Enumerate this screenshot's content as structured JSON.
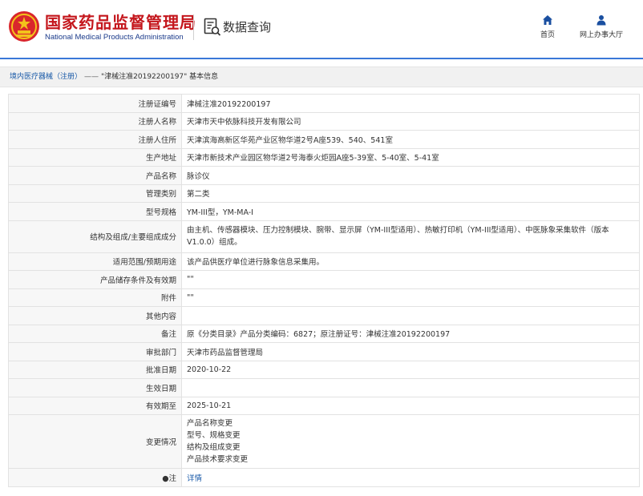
{
  "header": {
    "title_cn": "国家药品监督管理局",
    "title_en": "National Medical Products Administration",
    "query_label": "数据查询",
    "nav": [
      {
        "label": "首页",
        "icon": "home-icon"
      },
      {
        "label": "网上办事大厅",
        "icon": "user-icon"
      }
    ]
  },
  "breadcrumb": {
    "parent": "境内医疗器械（注册）",
    "separator": "——",
    "current": "\"津械注准20192200197\" 基本信息"
  },
  "rows": [
    {
      "key": "注册证编号",
      "value": "津械注准20192200197"
    },
    {
      "key": "注册人名称",
      "value": "天津市天中依脉科技开发有限公司"
    },
    {
      "key": "注册人住所",
      "value": "天津滨海高新区华苑产业区物华道2号A座539、540、541室"
    },
    {
      "key": "生产地址",
      "value": "天津市新技术产业园区物华道2号海泰火炬园A座5-39室、5-40室、5-41室"
    },
    {
      "key": "产品名称",
      "value": "脉诊仪"
    },
    {
      "key": "管理类别",
      "value": "第二类"
    },
    {
      "key": "型号规格",
      "value": "YM-III型，YM-MA-I"
    },
    {
      "key": "结构及组成/主要组成成分",
      "value": "由主机、传感器模块、压力控制模块、腕带、显示屏（YM-III型适用）、热敏打印机（YM-III型适用）、中医脉象采集软件（版本V1.0.0）组成。"
    },
    {
      "key": "适用范围/预期用途",
      "value": "该产品供医疗单位进行脉象信息采集用。"
    },
    {
      "key": "产品储存条件及有效期",
      "value": "\"\""
    },
    {
      "key": "附件",
      "value": "\"\""
    },
    {
      "key": "其他内容",
      "value": ""
    },
    {
      "key": "备注",
      "value": "原《分类目录》产品分类编码：6827；原注册证号：津械注准20192200197"
    },
    {
      "key": "审批部门",
      "value": "天津市药品监督管理局"
    },
    {
      "key": "批准日期",
      "value": "2020-10-22"
    },
    {
      "key": "生效日期",
      "value": ""
    },
    {
      "key": "有效期至",
      "value": "2025-10-21"
    }
  ],
  "changes": {
    "key": "变更情况",
    "items": [
      "产品名称变更",
      "型号、规格变更",
      "结构及组成变更",
      "产品技术要求变更"
    ]
  },
  "note": {
    "key": "注",
    "link": "详情"
  },
  "colors": {
    "brand_red": "#c4161c",
    "brand_blue": "#1a3a8a",
    "accent_blue": "#3a78d8",
    "link_blue": "#1a5aa8"
  }
}
